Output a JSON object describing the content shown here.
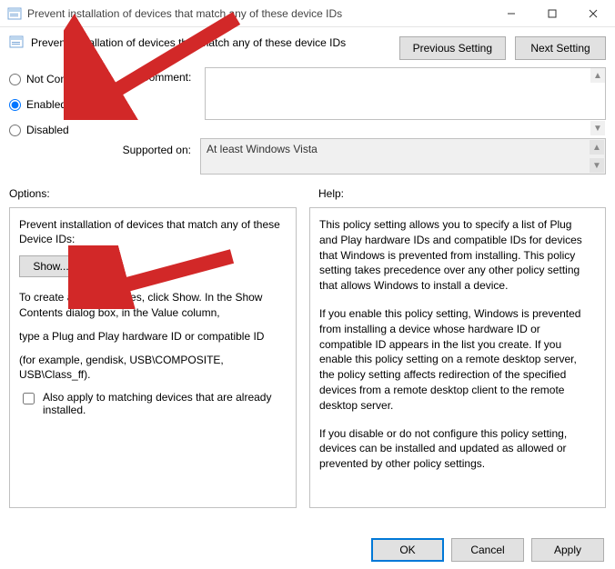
{
  "window": {
    "title": "Prevent installation of devices that match any of these device IDs"
  },
  "header": {
    "policy_title": "Prevent installation of devices that match any of these device IDs",
    "prev_btn": "Previous Setting",
    "next_btn": "Next Setting"
  },
  "state": {
    "not_configured": "Not Configured",
    "enabled": "Enabled",
    "disabled": "Disabled",
    "selected": "enabled",
    "comment_label": "Comment:",
    "comment_value": ""
  },
  "supported": {
    "label": "Supported on:",
    "value": "At least Windows Vista"
  },
  "sections": {
    "options": "Options:",
    "help": "Help:"
  },
  "options": {
    "heading": "Prevent installation of devices that match any of these Device IDs:",
    "show_btn": "Show...",
    "hint1": "To create a list of devices, click Show. In the Show Contents dialog box, in the Value column,",
    "hint2": "type a Plug and Play hardware ID or compatible ID",
    "hint3": "(for example, gendisk, USB\\COMPOSITE, USB\\Class_ff).",
    "checkbox_label": "Also apply to matching devices that are already installed.",
    "checkbox_checked": false
  },
  "help": {
    "p1": "This policy setting allows you to specify a list of Plug and Play hardware IDs and compatible IDs for devices that Windows is prevented from installing. This policy setting takes precedence over any other policy setting that allows Windows to install a device.",
    "p2": "If you enable this policy setting, Windows is prevented from installing a device whose hardware ID or compatible ID appears in the list you create. If you enable this policy setting on a remote desktop server, the policy setting affects redirection of the specified devices from a remote desktop client to the remote desktop server.",
    "p3": "If you disable or do not configure this policy setting, devices can be installed and updated as allowed or prevented by other policy settings."
  },
  "footer": {
    "ok": "OK",
    "cancel": "Cancel",
    "apply": "Apply"
  },
  "annotations": {
    "arrow_color": "#d22828"
  }
}
